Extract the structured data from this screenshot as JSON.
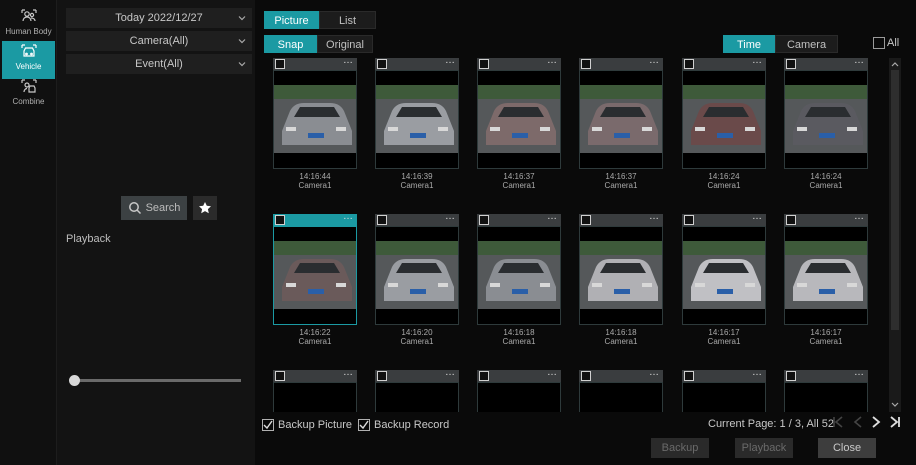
{
  "rail": {
    "items": [
      {
        "label": "Human Body",
        "icon": "person-icon",
        "active": false
      },
      {
        "label": "Vehicle",
        "icon": "car-icon",
        "active": true
      },
      {
        "label": "Combine",
        "icon": "combine-icon",
        "active": false
      }
    ]
  },
  "filters": {
    "date": "Today 2022/12/27",
    "camera": "Camera(All)",
    "event": "Event(All)"
  },
  "search_label": "Search",
  "playback_label": "Playback",
  "view_tabs": {
    "picture": "Picture",
    "list": "List"
  },
  "type_tabs": {
    "snap": "Snap",
    "original": "Original"
  },
  "sort_tabs": {
    "time": "Time",
    "camera": "Camera"
  },
  "all_label": "All",
  "snapshots": [
    {
      "time": "14:16:44",
      "camera": "Camera1",
      "color": "#8a8d92"
    },
    {
      "time": "14:16:39",
      "camera": "Camera1",
      "color": "#9a9da2"
    },
    {
      "time": "14:16:37",
      "camera": "Camera1",
      "color": "#7d6a6a"
    },
    {
      "time": "14:16:37",
      "camera": "Camera1",
      "color": "#7a6a6c"
    },
    {
      "time": "14:16:24",
      "camera": "Camera1",
      "color": "#6a4a4a"
    },
    {
      "time": "14:16:24",
      "camera": "Camera1",
      "color": "#5a5a60"
    },
    {
      "time": "14:16:22",
      "camera": "Camera1",
      "color": "#6a5a5a"
    },
    {
      "time": "14:16:20",
      "camera": "Camera1",
      "color": "#9a9da2"
    },
    {
      "time": "14:16:18",
      "camera": "Camera1",
      "color": "#8a8d92"
    },
    {
      "time": "14:16:18",
      "camera": "Camera1",
      "color": "#b0b0b4"
    },
    {
      "time": "14:16:17",
      "camera": "Camera1",
      "color": "#c0c0c4"
    },
    {
      "time": "14:16:17",
      "camera": "Camera1",
      "color": "#b8b8bc"
    }
  ],
  "selected_index": 6,
  "backup_picture_label": "Backup Picture",
  "backup_record_label": "Backup Record",
  "page_info": "Current Page: 1 / 3, All 52",
  "buttons": {
    "backup": "Backup",
    "playback": "Playback",
    "close": "Close"
  },
  "colors": {
    "accent": "#1b9aa3",
    "background": "#0a0a0a"
  }
}
